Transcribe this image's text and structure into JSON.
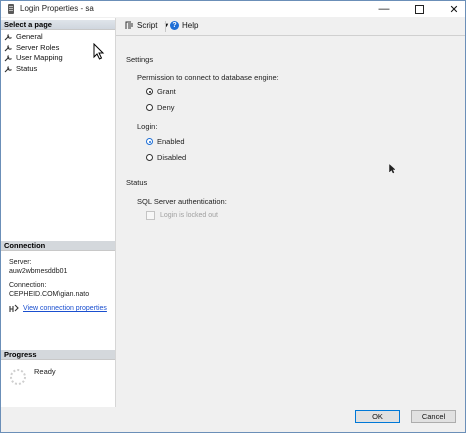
{
  "window": {
    "title": "Login Properties - sa",
    "controls": {
      "minimize": "—",
      "close": "✕"
    }
  },
  "left_pane": {
    "select_header": "Select a page",
    "pages": [
      {
        "label": "General",
        "icon": "wrench-icon"
      },
      {
        "label": "Server Roles",
        "icon": "wrench-icon"
      },
      {
        "label": "User Mapping",
        "icon": "wrench-icon"
      },
      {
        "label": "Status",
        "icon": "wrench-icon"
      }
    ],
    "connection": {
      "header": "Connection",
      "server_label": "Server:",
      "server_value": "auw2wbmesddb01",
      "connection_label": "Connection:",
      "connection_value": "CEPHEID.COM\\gian.nato",
      "link": "View connection properties"
    },
    "progress": {
      "header": "Progress",
      "status": "Ready"
    }
  },
  "toolbar": {
    "script_label": "Script",
    "help_label": "Help"
  },
  "settings": {
    "header": "Settings",
    "permission_label": "Permission to connect to database engine:",
    "grant_label": "Grant",
    "deny_label": "Deny",
    "login_label": "Login:",
    "enabled_label": "Enabled",
    "disabled_label": "Disabled",
    "permission_value": "Grant",
    "login_value": "Enabled"
  },
  "status": {
    "header": "Status",
    "sql_auth_label": "SQL Server authentication:",
    "locked_out_label": "Login is locked out",
    "locked_out_checked": false
  },
  "buttons": {
    "ok": "OK",
    "cancel": "Cancel"
  },
  "colors": {
    "accent": "#1f6fd6",
    "link": "#1a4fcf",
    "window_border": "#6b8fb8"
  }
}
